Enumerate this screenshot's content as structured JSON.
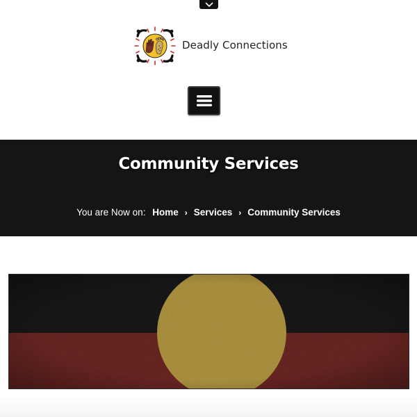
{
  "site": {
    "name": "Deadly Connections"
  },
  "header": {
    "top_toggle_icon": "chevron-down-icon",
    "menu_icon": "hamburger-menu-icon"
  },
  "page_header": {
    "title": "Community Services",
    "breadcrumb": {
      "prefix": "You are Now on:",
      "separator": "›",
      "items": [
        "Home",
        "Services",
        "Community Services"
      ]
    }
  },
  "banner": {
    "colors": {
      "top": "#1f1f1f",
      "bottom": "#6e2b26",
      "circle": "#b59a45"
    }
  }
}
